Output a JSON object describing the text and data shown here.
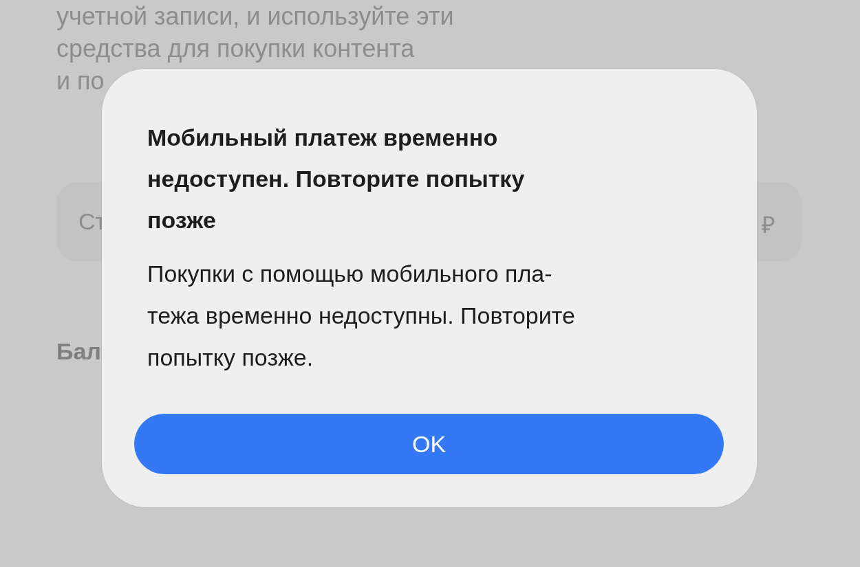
{
  "background": {
    "paragraph_lines": [
      "учетной записи, и используйте эти",
      "средства для покупки контента",
      "и по"
    ],
    "amount_field": {
      "placeholder": "Ст",
      "currency": "₽"
    },
    "balance_label": "Бал"
  },
  "alert": {
    "title_lines": [
      "Мобильный платеж временно",
      "недоступен. Повторите попытку",
      "позже"
    ],
    "message_lines": [
      "Покупки с помощью мобильного пла-",
      "тежа временно недоступны. Повторите",
      "попытку позже."
    ],
    "buttons": [
      {
        "label": "OK",
        "kind": "primary"
      }
    ]
  }
}
